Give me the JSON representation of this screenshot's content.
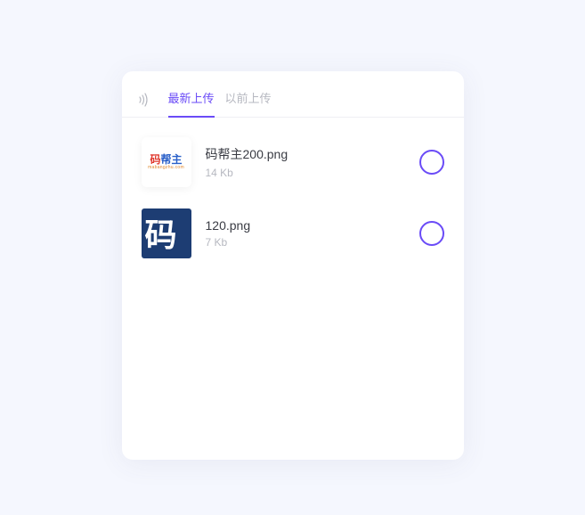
{
  "tabs": {
    "recent": "最新上传",
    "previous": "以前上传"
  },
  "files": [
    {
      "name": "码帮主200.png",
      "size": "14 Kb"
    },
    {
      "name": "120.png",
      "size": "7 Kb"
    }
  ],
  "thumb_brand": {
    "text": "码帮主",
    "sub": "mabangzhu.com"
  },
  "thumb_dark_char": "码"
}
